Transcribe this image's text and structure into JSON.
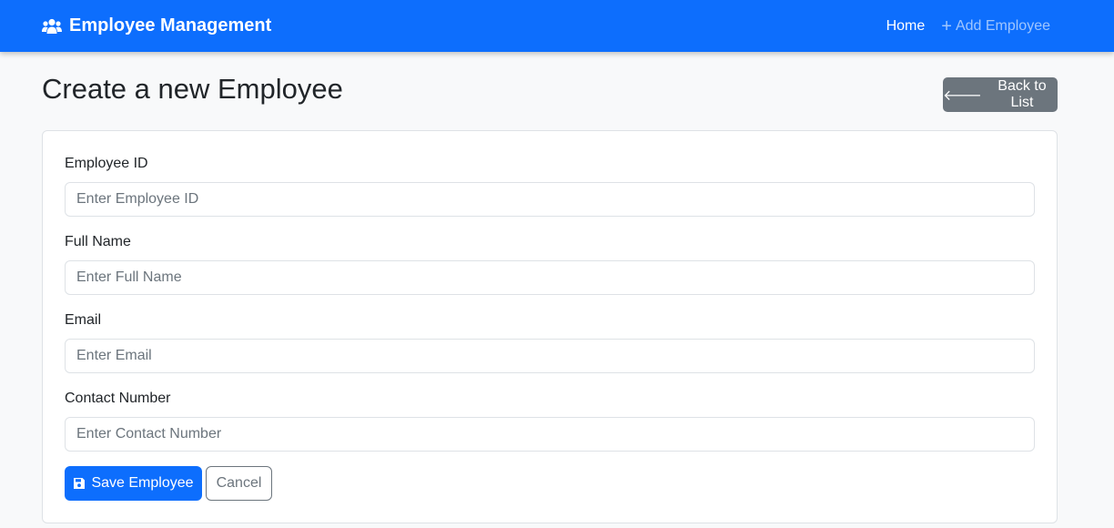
{
  "navbar": {
    "brand_icon": "users-icon",
    "brand_label": "Employee Management",
    "links": [
      {
        "label": "Home"
      },
      {
        "label": "Add Employee",
        "icon": "plus-icon"
      }
    ],
    "accent_color": "#0d6efd"
  },
  "page": {
    "title": "Create a new Employee",
    "back_button": {
      "label": "Back to List",
      "icon": "arrow-left-icon"
    }
  },
  "form": {
    "fields": [
      {
        "label": "Employee ID",
        "placeholder": "Enter Employee ID",
        "value": ""
      },
      {
        "label": "Full Name",
        "placeholder": "Enter Full Name",
        "value": ""
      },
      {
        "label": "Email",
        "placeholder": "Enter Email",
        "value": ""
      },
      {
        "label": "Contact Number",
        "placeholder": "Enter Contact Number",
        "value": ""
      }
    ],
    "save_button": {
      "label": "Save Employee",
      "icon": "floppy-disk-icon"
    },
    "cancel_button": {
      "label": "Cancel"
    }
  }
}
